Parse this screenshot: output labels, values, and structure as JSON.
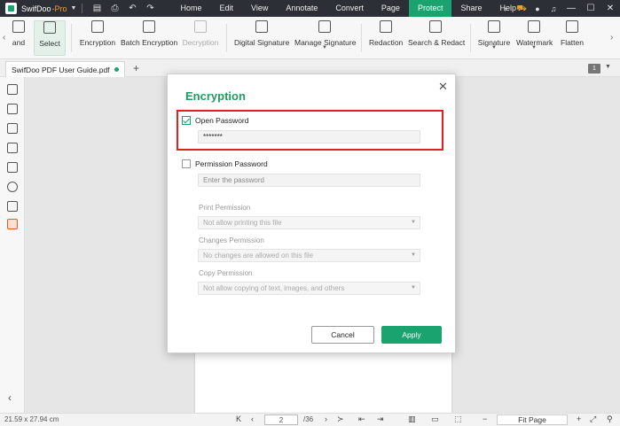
{
  "titlebar": {
    "app_name": "SwifDoo",
    "edition": "-Pro",
    "menu": [
      "Home",
      "Edit",
      "View",
      "Annotate",
      "Convert",
      "Page",
      "Protect",
      "Share",
      "Help"
    ],
    "active_menu": "Protect",
    "icons": [
      "save-icon",
      "print-icon",
      "undo-icon",
      "redo-icon"
    ],
    "right_icons": [
      "cart-icon",
      "user-icon",
      "bell-icon"
    ],
    "window_controls": [
      "minimize",
      "maximize",
      "close"
    ]
  },
  "ribbon": {
    "items": [
      {
        "label": "and",
        "icon": "hand-icon"
      },
      {
        "label": "Select",
        "icon": "cursor-icon"
      },
      {
        "label": "Encryption",
        "icon": "lock-icon"
      },
      {
        "label": "Batch Encryption",
        "icon": "batch-lock-icon"
      },
      {
        "label": "Decryption",
        "icon": "unlock-icon"
      },
      {
        "label": "Digital Signature",
        "icon": "digital-signature-icon"
      },
      {
        "label": "Manage Signature",
        "icon": "manage-signature-icon"
      },
      {
        "label": "Redaction",
        "icon": "redaction-icon"
      },
      {
        "label": "Search & Redact",
        "icon": "search-redact-icon"
      },
      {
        "label": "Signature",
        "icon": "signature-icon"
      },
      {
        "label": "Watermark",
        "icon": "watermark-icon"
      },
      {
        "label": "Flatten",
        "icon": "flatten-icon"
      }
    ]
  },
  "tabs": {
    "doc_name": "SwifDoo PDF User Guide.pdf",
    "new_tab": "+",
    "page_badge": "1"
  },
  "statusbar": {
    "dimensions": "21.59 x 27.94 cm",
    "current_page": "2",
    "total_pages": "/36",
    "zoom": "Fit Page"
  },
  "dialog": {
    "title": "Encryption",
    "open_password": {
      "label": "Open Password",
      "checked": true,
      "value": "*******"
    },
    "permission_password": {
      "label": "Permission Password",
      "checked": false,
      "placeholder": "Enter the password"
    },
    "print_permission": {
      "label": "Print Permission",
      "value": "Not allow printing this file"
    },
    "changes_permission": {
      "label": "Changes Permission",
      "value": "No changes are allowed on this file"
    },
    "copy_permission": {
      "label": "Copy Permission",
      "value": "Not allow copying of text, images, and others"
    },
    "cancel_label": "Cancel",
    "apply_label": "Apply"
  },
  "colors": {
    "accent": "#1aa36f",
    "highlight": "#e02020",
    "titlebar": "#2c2f36"
  }
}
